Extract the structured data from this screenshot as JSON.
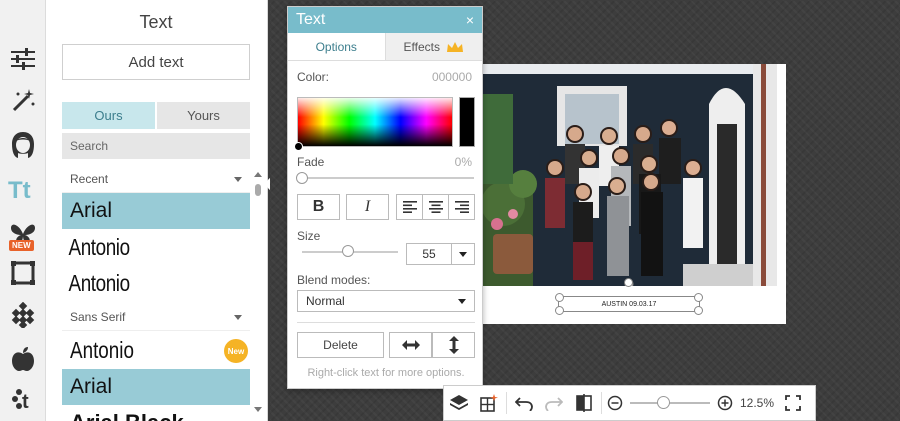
{
  "panel": {
    "title": "Text",
    "add_text_label": "Add text",
    "tabs": [
      "Ours",
      "Yours"
    ],
    "search_placeholder": "Search",
    "sections": [
      {
        "label": "Recent",
        "fonts": [
          "Arial",
          "Antonio",
          "Antonio"
        ]
      },
      {
        "label": "Sans Serif",
        "fonts": [
          "Antonio",
          "Arial",
          "Arial Black"
        ]
      }
    ],
    "new_badge": "New"
  },
  "rail": {
    "new_tag": "NEW",
    "tools": [
      "sliders-icon",
      "magic-wand-icon",
      "face-icon",
      "text-icon",
      "butterfly-icon",
      "frame-icon",
      "texture-icon",
      "apple-icon",
      "theme-icon"
    ]
  },
  "dialog": {
    "title": "Text",
    "close_glyph": "×",
    "tabs": [
      "Options",
      "Effects"
    ],
    "color_label": "Color:",
    "color_value": "000000",
    "fade_label": "Fade",
    "fade_value": "0%",
    "bold_glyph": "B",
    "italic_glyph": "I",
    "size_label": "Size",
    "size_value": "55",
    "blend_label": "Blend modes:",
    "blend_value": "Normal",
    "delete_label": "Delete",
    "hint": "Right-click text for more options."
  },
  "canvas": {
    "caption": "AUSTIN 09.03.17"
  },
  "toolbar": {
    "zoom_value": "12.5%",
    "zoom_level": 0.4
  },
  "colors": {
    "accent": "#78bccb",
    "selected_row": "#98cbd6",
    "badge": "#f5b325",
    "new_tag": "#e8622a"
  }
}
